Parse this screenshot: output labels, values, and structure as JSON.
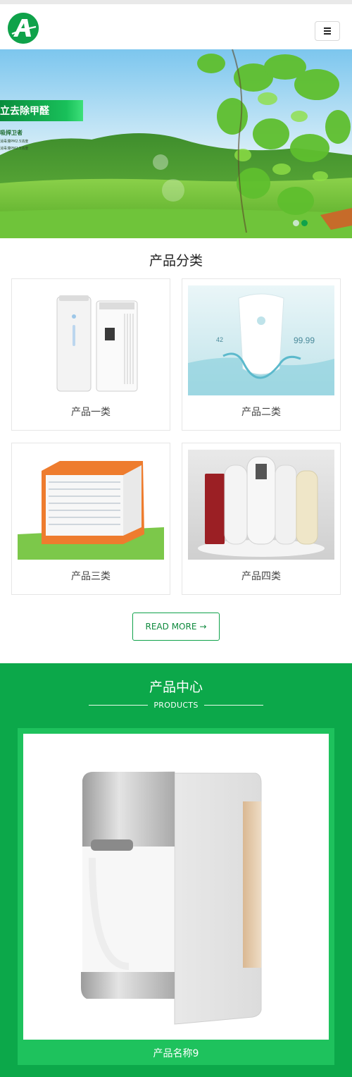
{
  "header": {
    "logo_letter": "A",
    "menu_icon": "hamburger-icon"
  },
  "banner": {
    "title": "立去除甲醛",
    "subtitle": "吸捍卫者",
    "lines": [
      "消毒灌PM2.5浓度",
      "消毒灌PM2.5浓度"
    ],
    "slides": [
      {
        "active": false
      },
      {
        "active": true
      }
    ],
    "colors": {
      "accent": "#19c05a",
      "dot_active": "#0fa24a",
      "dot_inactive": "#c8e6c9"
    }
  },
  "categories": {
    "title": "产品分类",
    "items": [
      {
        "label": "产品一类",
        "image": "air-purifier-photo"
      },
      {
        "label": "产品二类",
        "image": "water-purifier-photo"
      },
      {
        "label": "产品三类",
        "image": "evaporative-cooler-photo"
      },
      {
        "label": "产品四类",
        "image": "water-dispensers-photo"
      }
    ],
    "read_more": "READ MORE",
    "read_more_icon": "arrow-right-icon"
  },
  "products": {
    "title": "产品中心",
    "subtitle": "PRODUCTS",
    "items": [
      {
        "name": "产品名称9",
        "image": "countertop-water-purifier-photo"
      }
    ],
    "colors": {
      "band": "#0ca84a",
      "card": "#1ec25d"
    }
  }
}
